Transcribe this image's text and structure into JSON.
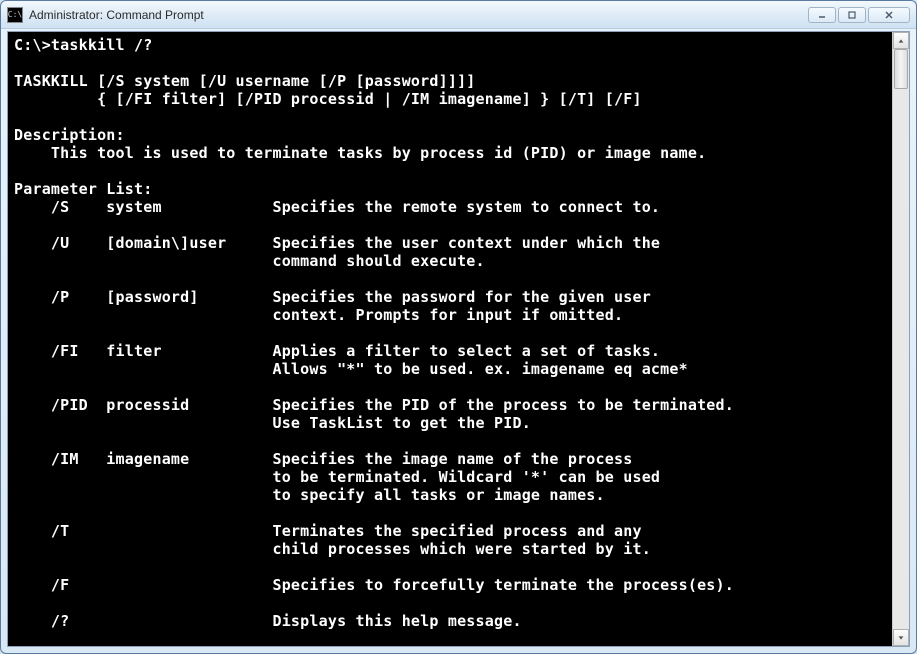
{
  "window": {
    "title": "Administrator: Command Prompt",
    "icon_label": "C:\\"
  },
  "prompt": {
    "path": "C:\\>",
    "command": "taskkill /?"
  },
  "usage": {
    "line1": "TASKKILL [/S system [/U username [/P [password]]]]",
    "line2": "         { [/FI filter] [/PID processid | /IM imagename] } [/T] [/F]"
  },
  "description": {
    "heading": "Description:",
    "text": "    This tool is used to terminate tasks by process id (PID) or image name."
  },
  "paramlist_heading": "Parameter List:",
  "params": [
    {
      "flag": "/S",
      "arg": "system",
      "desc": [
        "Specifies the remote system to connect to."
      ]
    },
    {
      "flag": "/U",
      "arg": "[domain\\]user",
      "desc": [
        "Specifies the user context under which the",
        "command should execute."
      ]
    },
    {
      "flag": "/P",
      "arg": "[password]",
      "desc": [
        "Specifies the password for the given user",
        "context. Prompts for input if omitted."
      ]
    },
    {
      "flag": "/FI",
      "arg": "filter",
      "desc": [
        "Applies a filter to select a set of tasks.",
        "Allows \"*\" to be used. ex. imagename eq acme*"
      ]
    },
    {
      "flag": "/PID",
      "arg": "processid",
      "desc": [
        "Specifies the PID of the process to be terminated.",
        "Use TaskList to get the PID."
      ]
    },
    {
      "flag": "/IM",
      "arg": "imagename",
      "desc": [
        "Specifies the image name of the process",
        "to be terminated. Wildcard '*' can be used",
        "to specify all tasks or image names."
      ]
    },
    {
      "flag": "/T",
      "arg": "",
      "desc": [
        "Terminates the specified process and any",
        "child processes which were started by it."
      ]
    },
    {
      "flag": "/F",
      "arg": "",
      "desc": [
        "Specifies to forcefully terminate the process(es)."
      ]
    },
    {
      "flag": "/?",
      "arg": "",
      "desc": [
        "Displays this help message."
      ]
    }
  ]
}
